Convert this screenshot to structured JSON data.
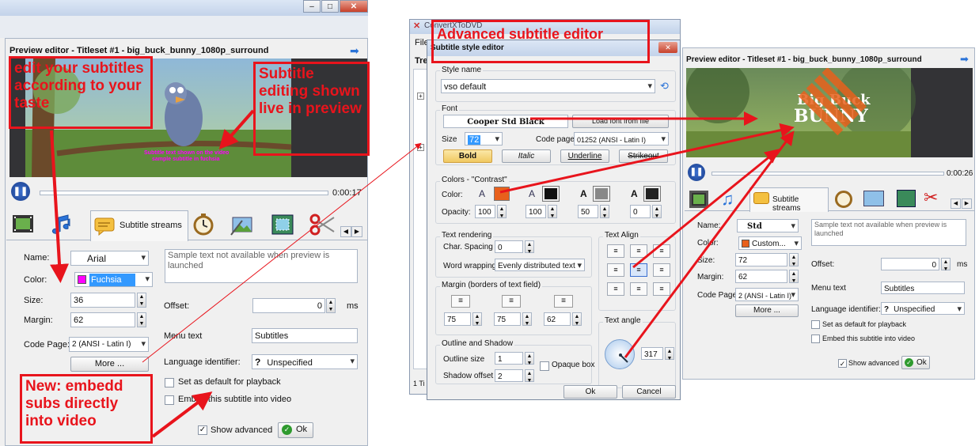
{
  "left": {
    "preview_title": "Preview editor - Titleset #1 - big_buck_bunny_1080p_surround",
    "time": "0:00:17",
    "subtitle_line1": "Subtitle text shown on the video",
    "subtitle_line2": "sample subtitle in fuchsia",
    "tab_subtitle": "Subtitle streams",
    "name_label": "Name:",
    "name_value": "Arial",
    "color_label": "Color:",
    "color_value": "Fuchsia",
    "size_label": "Size:",
    "size_value": "36",
    "margin_label": "Margin:",
    "margin_value": "62",
    "codepage_label": "Code Page:",
    "codepage_value": "2 (ANSI - Latin I)",
    "more_button": "More ...",
    "sample_text": "Sample text not available when preview is launched",
    "offset_label": "Offset:",
    "offset_value": "0",
    "offset_unit": "ms",
    "menu_text_label": "Menu text",
    "menu_text_value": "Subtitles",
    "lang_label": "Language identifier:",
    "lang_value": "Unspecified",
    "default_playback": "Set as default for playback",
    "embed_label": "Embed this subtitle into video",
    "show_advanced": "Show advanced",
    "ok_button": "Ok"
  },
  "annotations": {
    "edit": "edit your subtitles according to your taste",
    "live": "Subtitle editing shown live in preview",
    "embed": "New: embedd subs directly into video",
    "advanced": "Advanced subtitle editor"
  },
  "middle": {
    "app_title": "ConvertXToDVD",
    "file_menu": "File",
    "tree_label": "Tre",
    "status_text": "1 Ti",
    "dialog_title": "Subtitle style editor",
    "style_name_group": "Style name",
    "style_name_value": "vso default",
    "font_group": "Font",
    "font_value": "Cooper Std Black",
    "load_font_button": "Load font from file",
    "size_label": "Size",
    "size_value": "72",
    "codepage_label": "Code page",
    "codepage_value": "01252 (ANSI - Latin I)",
    "bold": "Bold",
    "italic": "Italic",
    "underline": "Underline",
    "strikeout": "Strikeout",
    "colors_group": "Colors - \"Contrast\"",
    "color_label": "Color:",
    "opacity_label": "Opacity:",
    "opacities": [
      "100",
      "100",
      "50",
      "0"
    ],
    "rendering_group": "Text rendering",
    "char_spacing_label": "Char. Spacing",
    "char_spacing_value": "0",
    "word_wrap_label": "Word wrapping",
    "word_wrap_value": "Evenly distributed text",
    "align_group": "Text Align",
    "margin_group": "Margin  (borders of text field)",
    "margins": [
      "75",
      "75",
      "62"
    ],
    "angle_group": "Text angle",
    "angle_value": "317",
    "outline_group": "Outline  and Shadow",
    "outline_label": "Outline size",
    "outline_value": "1",
    "shadow_label": "Shadow offset",
    "shadow_value": "2",
    "opaque_box": "Opaque box",
    "ok_button": "Ok",
    "cancel_button": "Cancel"
  },
  "right": {
    "preview_title": "Preview editor - Titleset #1 - big_buck_bunny_1080p_surround",
    "video_title_1": "Big Buck",
    "video_title_2": "BUNNY",
    "time": "0:00:26",
    "tab_subtitle": "Subtitle streams",
    "name_label": "Name:",
    "name_value": "Std",
    "color_label": "Color:",
    "color_value": "Custom...",
    "size_label": "Size:",
    "size_value": "72",
    "margin_label": "Margin:",
    "margin_value": "62",
    "codepage_label": "Code Page:",
    "codepage_value": "2 (ANSI - Latin I)",
    "more_button": "More ...",
    "sample_text": "Sample text not available when preview is launched",
    "offset_label": "Offset:",
    "offset_value": "0",
    "offset_unit": "ms",
    "menu_text_label": "Menu text",
    "menu_text_value": "Subtitles",
    "lang_label": "Language identifier:",
    "lang_value": "Unspecified",
    "default_playback": "Set as default for playback",
    "embed_label": "Embed this subtitle into video",
    "show_advanced": "Show advanced",
    "ok_button": "Ok"
  },
  "colors": {
    "annotation_red": "#e8141c",
    "fuchsia": "#ff00ff",
    "highlight_blue": "#3399ff",
    "orange": "#e8601c"
  }
}
